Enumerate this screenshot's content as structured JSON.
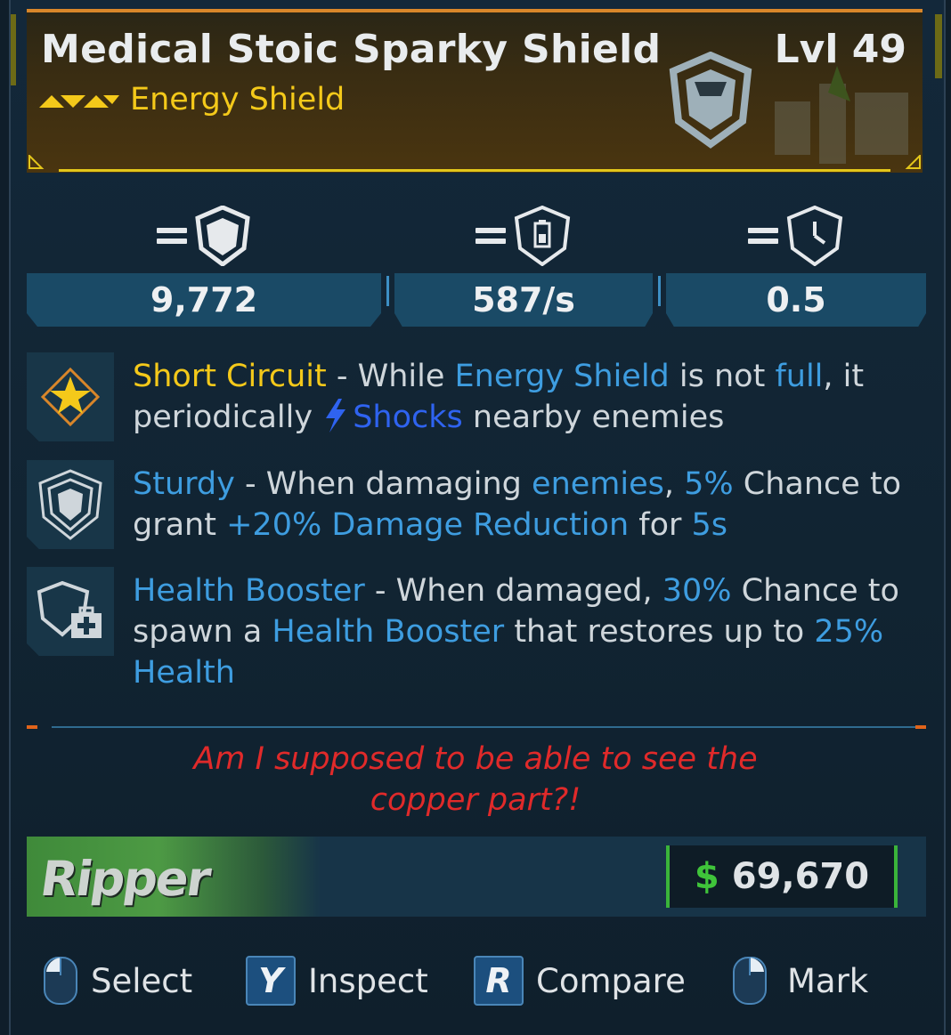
{
  "item": {
    "name": "Medical Stoic Sparky Shield",
    "level": "Lvl 49",
    "type": "Energy Shield",
    "rarity_icon": "triple-chevron-icon",
    "category_icon": "shield-icon"
  },
  "stats": [
    {
      "icon": "shield-capacity-icon",
      "value": "9,772"
    },
    {
      "icon": "recharge-rate-icon",
      "value": "587/s"
    },
    {
      "icon": "recharge-delay-icon",
      "value": "0.5"
    }
  ],
  "perks": [
    {
      "icon": "star-badge-icon",
      "name": "Short Circuit",
      "dash": " - ",
      "t1": "While ",
      "kw1": "Energy Shield",
      "t2": " is not ",
      "kw2": "full",
      "t3": ", it periodically ",
      "shock_icon": "lightning-icon",
      "kw3": "Shocks",
      "t4": " nearby enemies"
    },
    {
      "icon": "sturdy-shield-icon",
      "name": "Sturdy",
      "dash": " - ",
      "t1": "When damaging ",
      "kw1": "enemies",
      "t2": ", ",
      "kw2": "5%",
      "t3": " Chance to grant ",
      "kw3": "+20% Damage Reduction",
      "t4": " for ",
      "kw4": "5s"
    },
    {
      "icon": "health-booster-icon",
      "name": "Health Booster",
      "dash": " - ",
      "t1": "When damaged, ",
      "kw1": "30%",
      "t2": " Chance to spawn a ",
      "kw2": "Health Booster",
      "t3": " that restores up to ",
      "kw3": "25%",
      "t4": " ",
      "kw4": "Health"
    }
  ],
  "flavor": {
    "line1": "Am I supposed to be able to see the",
    "line2": "copper part?!"
  },
  "manufacturer": {
    "name": "Ripper"
  },
  "price": {
    "currency_symbol": "$",
    "value": "69,670"
  },
  "hints": [
    {
      "icon": "mouse-left-icon",
      "label": "Select"
    },
    {
      "button": "Y",
      "label": "Inspect"
    },
    {
      "button": "R",
      "label": "Compare"
    },
    {
      "icon": "mouse-right-icon",
      "label": "Mark"
    }
  ],
  "colors": {
    "rarity_yellow": "#f4c91a",
    "keyword_blue": "#3e9de0",
    "shock_blue": "#2f63f0",
    "flavor_red": "#e02a2a",
    "price_green": "#3fc43a"
  }
}
